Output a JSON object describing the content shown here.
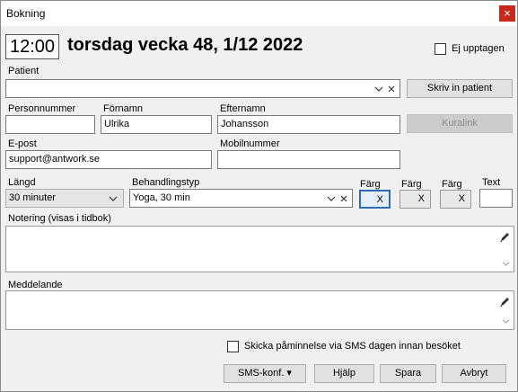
{
  "window": {
    "title": "Bokning",
    "close_glyph": "×"
  },
  "header": {
    "time": "12:00",
    "date_text": "torsdag vecka 48, 1/12 2022",
    "busy_label": "Ej upptagen",
    "busy_checked": false
  },
  "patient": {
    "label": "Patient",
    "value": "",
    "enter_button": "Skriv in patient"
  },
  "person": {
    "ssn_label": "Personnummer",
    "ssn_value": "",
    "first_label": "Förnamn",
    "first_value": "Ulrika",
    "last_label": "Efternamn",
    "last_value": "Johansson",
    "kuralink_button": "Kuralink",
    "email_label": "E-post",
    "email_value": "support@antwork.se",
    "mobile_label": "Mobilnummer",
    "mobile_value": ""
  },
  "booking": {
    "length_label": "Längd",
    "length_value": "30 minuter",
    "type_label": "Behandlingstyp",
    "type_value": "Yoga, 30 min",
    "color_label_1": "Färg",
    "color_value_1": "X",
    "color_label_2": "Färg",
    "color_value_2": "X",
    "color_label_3": "Färg",
    "color_value_3": "X",
    "text_label": "Text",
    "text_value": ""
  },
  "notes": {
    "label": "Notering (visas i tidbok)",
    "value": ""
  },
  "message": {
    "label": "Meddelande",
    "value": ""
  },
  "sms": {
    "reminder_label": "Skicka påminnelse via SMS dagen innan besöket",
    "checked": false
  },
  "footer": {
    "sms_conf_button": "SMS-konf. ▾",
    "help_button": "Hjälp",
    "save_button": "Spara",
    "cancel_button": "Avbryt"
  },
  "icons": {
    "chevron": "chevron-down-icon",
    "clear": "close-icon",
    "pen": "pencil-icon"
  }
}
